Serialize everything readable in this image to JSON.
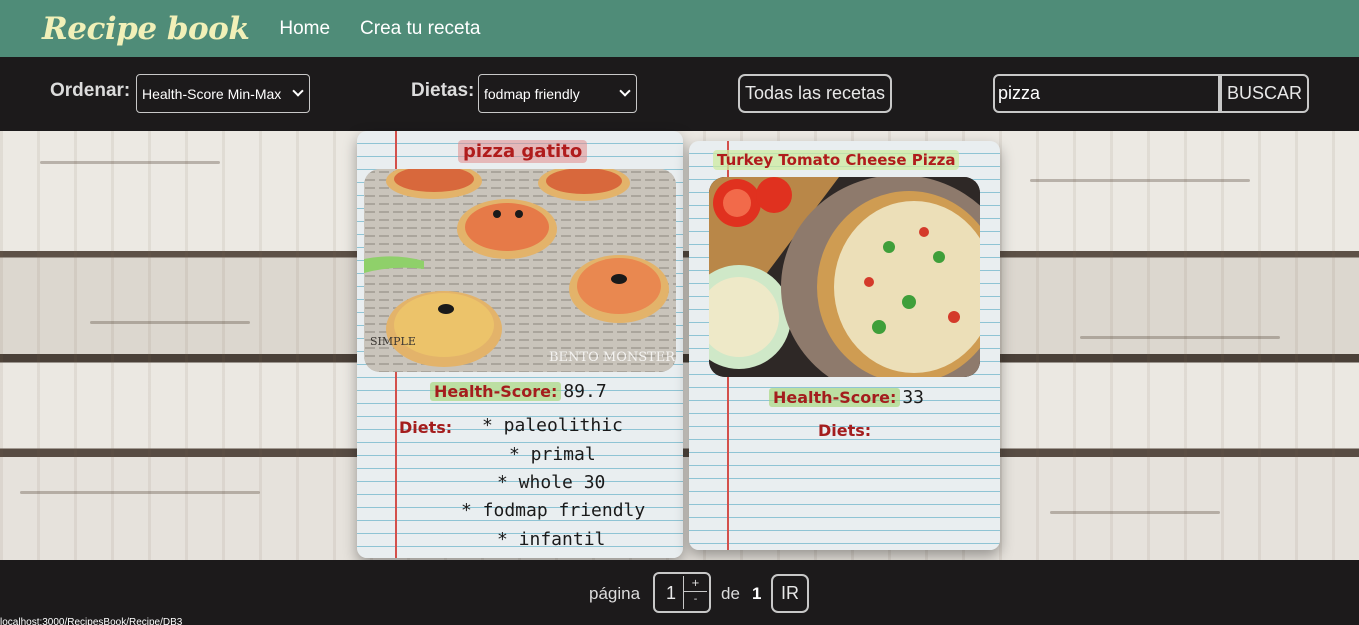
{
  "navbar": {
    "brand": "Recipe book",
    "links": [
      "Home",
      "Crea tu receta"
    ]
  },
  "filters": {
    "sort_label": "Ordenar:",
    "sort_value": "Health-Score Min-Max",
    "diet_label": "Dietas:",
    "diet_value": "fodmap friendly",
    "all_recipes_label": "Todas las recetas",
    "search_value": "pizza",
    "search_button": "BUSCAR"
  },
  "recipes": [
    {
      "title": "pizza gatito",
      "health_score_label": "Health-Score:",
      "health_score": "89.7",
      "diets_label": "Diets:",
      "diets": [
        "* paleolithic",
        "* primal",
        "* whole 30",
        "* fodmap friendly",
        "* infantil"
      ]
    },
    {
      "title": "Turkey Tomato Cheese Pizza",
      "health_score_label": "Health-Score:",
      "health_score": "33",
      "diets_label": "Diets:",
      "diets": []
    }
  ],
  "pagination": {
    "page_label": "página",
    "current_page": "1",
    "spin_up": "+",
    "spin_down": "-",
    "of_label": "de",
    "total_pages": "1",
    "go_button": "IR"
  },
  "status_bar": {
    "text": "localhost:3000/RecipesBook/Recipe/DB3"
  },
  "colors": {
    "navbar": "#4f8c78",
    "brand": "#f1f0b8",
    "dark_bar": "#1c1a1b",
    "title_red": "#b01c1c"
  }
}
